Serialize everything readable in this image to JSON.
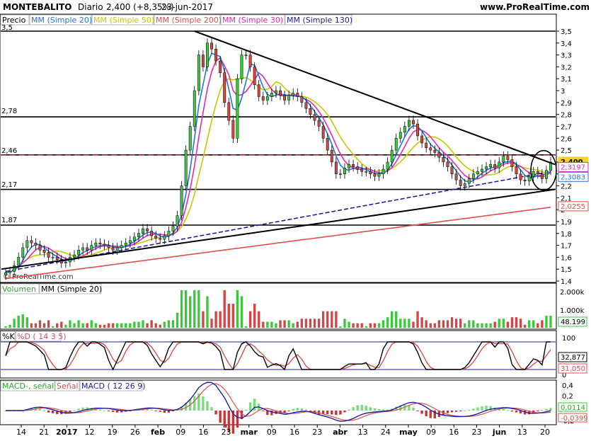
{
  "header": {
    "symbol": "MONTEBALITO",
    "period": "Diario",
    "last_value": "2,400 (+8,35%)",
    "date": "23-jun-2017",
    "site": "www.ProRealTime.com"
  },
  "legend": {
    "price": "Precio",
    "ma20": "MM (Simple 20)",
    "ma50": "MM (Simple 50)",
    "ma200": "MM (Simple 200)",
    "ma30": "MM (Simple 30)",
    "ma130": "MM (Simple 130)"
  },
  "colors": {
    "ma20": "#1e78dc",
    "ma50": "#c8c800",
    "ma200": "#dc5050",
    "ma30": "#e628b4",
    "ma130": "#1e1e9e",
    "up": "#3cc83c",
    "down": "#d24646",
    "macd_up": "#78dc78",
    "macd_down": "#c83232",
    "badge_last": "#f0d232",
    "grid": "#000000"
  },
  "watermark": "© ProRealTime.com",
  "chart_data": [
    {
      "type": "candlestick",
      "ylim": [
        1.4,
        3.5
      ],
      "y_ticks": [
        "1,4",
        "1,5",
        "1,6",
        "1,7",
        "1,8",
        "1,9",
        "2",
        "2,1",
        "2,2",
        "2,3",
        "2,4",
        "2,5",
        "2,6",
        "2,7",
        "2,8",
        "2,9",
        "3",
        "3,1",
        "3,2",
        "3,3",
        "3,4",
        "3,5"
      ],
      "horizontal_levels": [
        {
          "value": 3.5,
          "label": "3,5"
        },
        {
          "value": 2.78,
          "label": "2,78"
        },
        {
          "value": 2.46,
          "label": "2,46"
        },
        {
          "value": 2.17,
          "label": "2,17"
        },
        {
          "value": 1.87,
          "label": "1,87"
        }
      ],
      "resistance_level": 2.4,
      "last_close": 2.4,
      "close": [
        1.47,
        1.48,
        1.53,
        1.6,
        1.68,
        1.74,
        1.72,
        1.7,
        1.66,
        1.64,
        1.6,
        1.6,
        1.58,
        1.55,
        1.56,
        1.6,
        1.62,
        1.66,
        1.68,
        1.66,
        1.7,
        1.72,
        1.71,
        1.7,
        1.68,
        1.66,
        1.68,
        1.7,
        1.72,
        1.74,
        1.77,
        1.8,
        1.84,
        1.82,
        1.78,
        1.76,
        1.75,
        1.78,
        1.82,
        1.86,
        1.95,
        2.2,
        2.5,
        2.7,
        3.0,
        3.3,
        3.2,
        3.4,
        3.35,
        3.25,
        3.15,
        2.9,
        2.75,
        2.6,
        3.1,
        3.3,
        3.3,
        3.2,
        3.05,
        2.95,
        2.92,
        2.95,
        2.98,
        3.0,
        2.96,
        2.92,
        2.96,
        2.98,
        2.95,
        2.9,
        2.85,
        2.8,
        2.75,
        2.7,
        2.6,
        2.5,
        2.4,
        2.3,
        2.3,
        2.35,
        2.38,
        2.36,
        2.34,
        2.32,
        2.32,
        2.3,
        2.28,
        2.3,
        2.34,
        2.4,
        2.5,
        2.6,
        2.65,
        2.7,
        2.75,
        2.72,
        2.62,
        2.56,
        2.52,
        2.5,
        2.48,
        2.44,
        2.4,
        2.36,
        2.3,
        2.25,
        2.2,
        2.22,
        2.26,
        2.3,
        2.32,
        2.34,
        2.36,
        2.38,
        2.35,
        2.4,
        2.45,
        2.42,
        2.36,
        2.3,
        2.25,
        2.24,
        2.28,
        2.32,
        2.3,
        2.26,
        2.33,
        2.4
      ],
      "series": [
        {
          "name": "MM (Simple 20)"
        },
        {
          "name": "MM (Simple 50)"
        },
        {
          "name": "MM (Simple 200)"
        },
        {
          "name": "MM (Simple 30)"
        },
        {
          "name": "MM (Simple 130)"
        }
      ],
      "price_badges": [
        "2,400",
        "2,3197",
        "2,3083",
        "2,0255"
      ]
    },
    {
      "type": "bar",
      "label": "Volumen",
      "ma_label": "MM (Simple 20)",
      "y_ticks": [
        "2.000k",
        "1.000k"
      ],
      "last_value": "48.199"
    },
    {
      "type": "line",
      "label_k": "%K",
      "label_d": "%D ( 14 3 5)",
      "ylim": [
        0,
        100
      ],
      "y_ticks": [
        "100",
        "0"
      ],
      "badge_k": "32,877",
      "badge_d": "31,050"
    },
    {
      "type": "bar",
      "label_hist": "MACD-, señal",
      "label_signal": "Señal",
      "label_macd": "MACD ( 12 26 9)",
      "y_ticks": [
        "0,4",
        "0,2",
        "0",
        "-0,2"
      ],
      "badge_pos": "0,0114",
      "badge_neg": "-0,0399"
    }
  ],
  "x_axis_labels": [
    "14",
    "21",
    "2017",
    "12",
    "19",
    "26",
    "feb",
    "09",
    "16",
    "23",
    "mar",
    "09",
    "16",
    "23",
    "abr",
    "13",
    "24",
    "may",
    "09",
    "16",
    "23",
    "jun",
    "13",
    "20"
  ]
}
